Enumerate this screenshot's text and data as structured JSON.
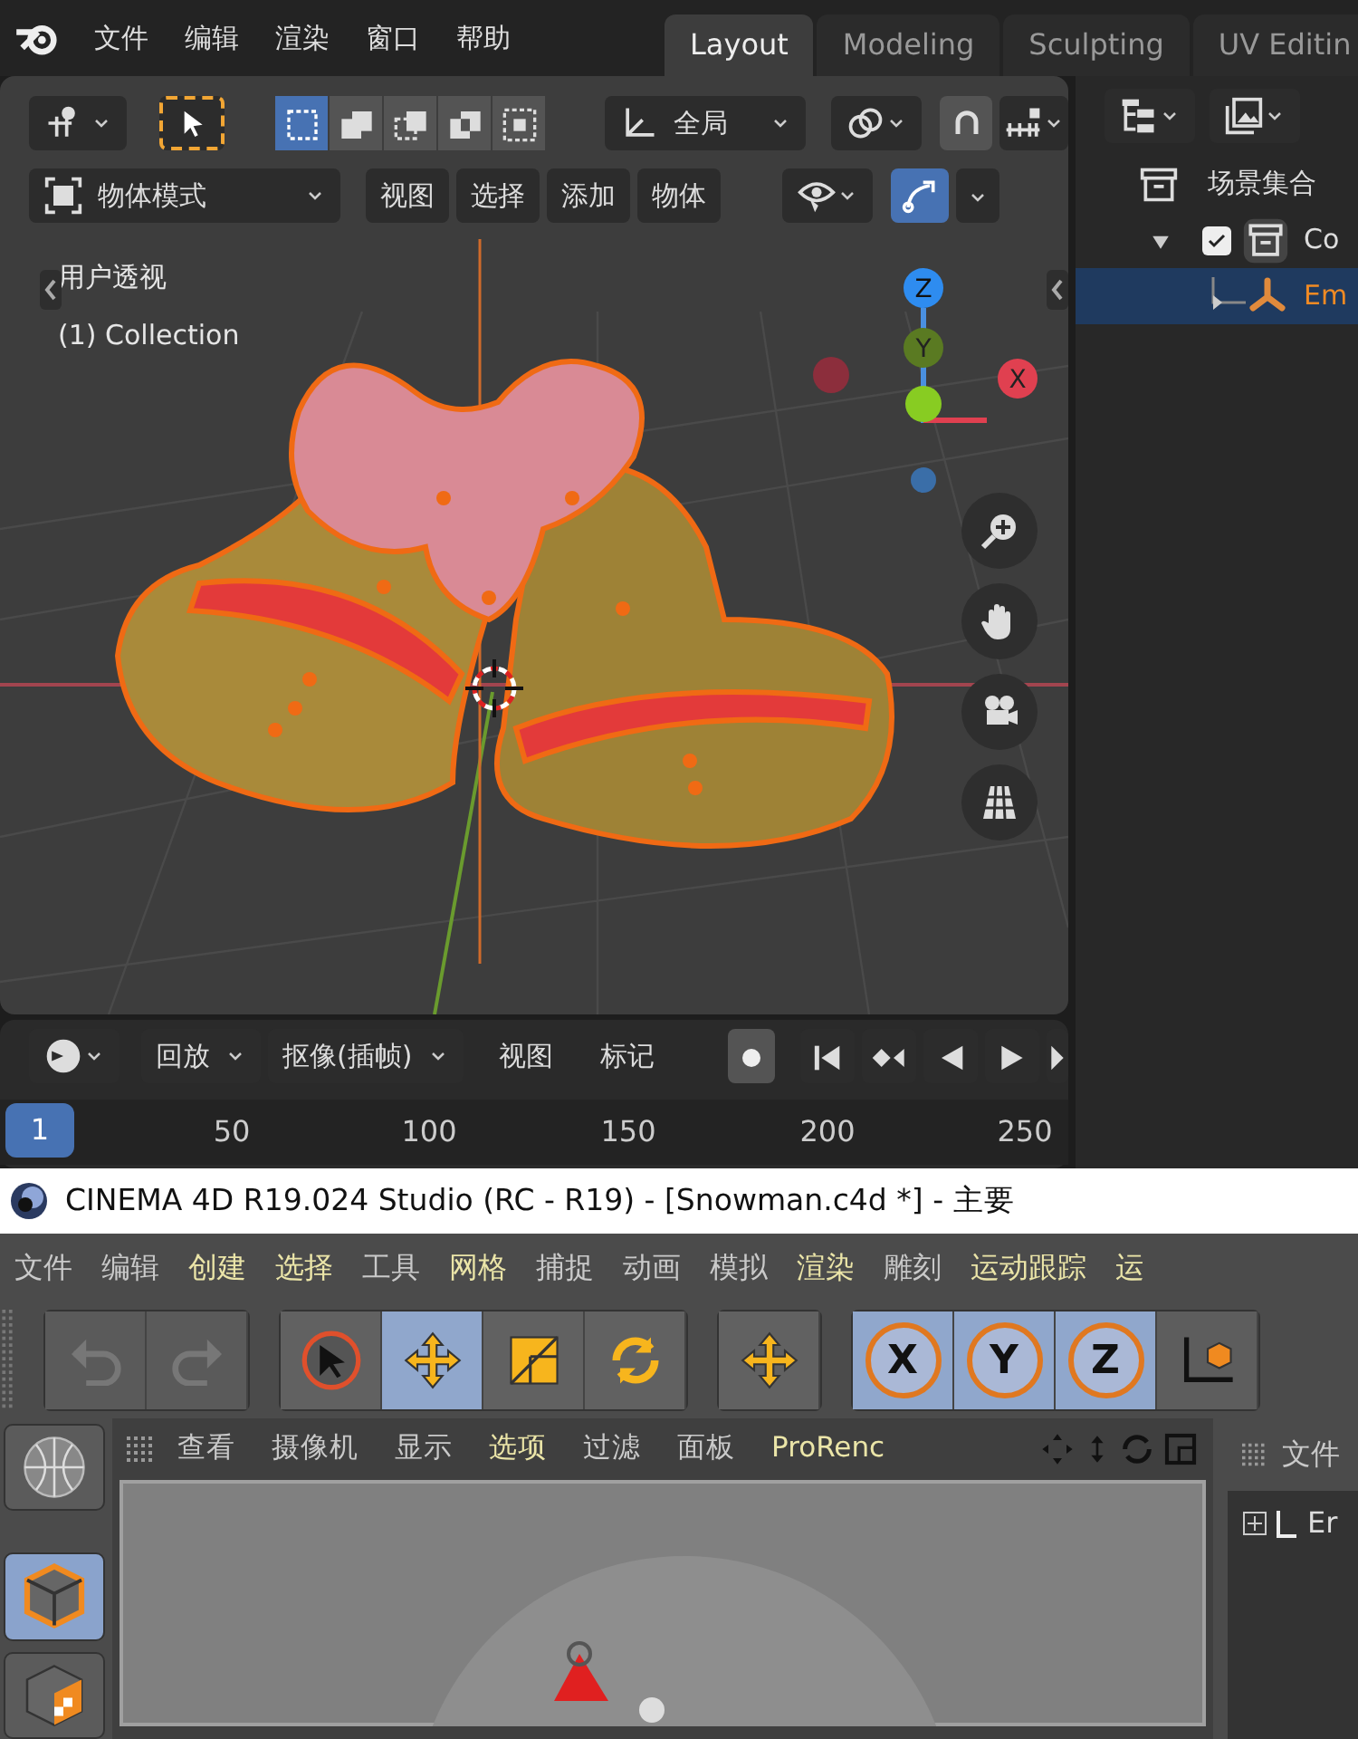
{
  "blender": {
    "menu": [
      "文件",
      "编辑",
      "渲染",
      "窗口",
      "帮助"
    ],
    "workspace_tabs": [
      {
        "label": "Layout",
        "selected": true
      },
      {
        "label": "Modeling",
        "selected": false
      },
      {
        "label": "Sculpting",
        "selected": false
      },
      {
        "label": "UV Editin",
        "selected": false
      }
    ],
    "select_modes": [
      {
        "kind": "new",
        "selected": true
      },
      {
        "kind": "extend",
        "selected": false
      },
      {
        "kind": "subtract",
        "selected": false
      },
      {
        "kind": "difference",
        "selected": false
      },
      {
        "kind": "intersect",
        "selected": false
      }
    ],
    "orientation": "全局",
    "snap_on": false,
    "mode": "物体模式",
    "header_menus": [
      "视图",
      "选择",
      "添加",
      "物体"
    ],
    "gizmo_toggle_on": true,
    "overlay_texts": [
      "用户透视",
      "(1) Collection"
    ],
    "gizmo_labels": {
      "z": "Z",
      "y": "Y",
      "x": "X"
    },
    "outliner": {
      "title": "场景集合",
      "items": [
        {
          "label": "Co",
          "checked": true,
          "selected": false,
          "children": [
            {
              "label": "Em",
              "selected": true
            }
          ]
        }
      ]
    },
    "timeline": {
      "playback": "回放",
      "keying": "抠像(插帧)",
      "menus": [
        "视图",
        "标记"
      ],
      "current_frame": "1",
      "ticks": [
        "50",
        "100",
        "150",
        "200",
        "250"
      ]
    }
  },
  "c4d": {
    "title": "CINEMA 4D R19.024 Studio (RC - R19) - [Snowman.c4d *] - 主要",
    "menu": [
      {
        "label": "文件",
        "highlighted": false
      },
      {
        "label": "编辑",
        "highlighted": false
      },
      {
        "label": "创建",
        "highlighted": true
      },
      {
        "label": "选择",
        "highlighted": true
      },
      {
        "label": "工具",
        "highlighted": false
      },
      {
        "label": "网格",
        "highlighted": true
      },
      {
        "label": "捕捉",
        "highlighted": false
      },
      {
        "label": "动画",
        "highlighted": false
      },
      {
        "label": "模拟",
        "highlighted": false
      },
      {
        "label": "渲染",
        "highlighted": true
      },
      {
        "label": "雕刻",
        "highlighted": false
      },
      {
        "label": "运动跟踪",
        "highlighted": true
      },
      {
        "label": "运",
        "highlighted": true
      }
    ],
    "history": [
      {
        "kind": "undo",
        "disabled": true
      },
      {
        "kind": "redo",
        "disabled": true
      }
    ],
    "tools": [
      {
        "kind": "select",
        "selected": false
      },
      {
        "kind": "move",
        "selected": true
      },
      {
        "kind": "scale",
        "selected": false
      },
      {
        "kind": "rotate",
        "selected": false
      }
    ],
    "axis_locks": [
      {
        "label": "X",
        "selected": true
      },
      {
        "label": "Y",
        "selected": true
      },
      {
        "label": "Z",
        "selected": true
      }
    ],
    "mode_tools": [
      {
        "kind": "globe",
        "selected": false
      },
      {
        "kind": "model",
        "selected": true
      },
      {
        "kind": "texture",
        "selected": false
      }
    ],
    "viewport_menu": [
      {
        "label": "查看",
        "highlighted": false
      },
      {
        "label": "摄像机",
        "highlighted": false
      },
      {
        "label": "显示",
        "highlighted": false
      },
      {
        "label": "选项",
        "highlighted": true
      },
      {
        "label": "过滤",
        "highlighted": false
      },
      {
        "label": "面板",
        "highlighted": false
      },
      {
        "label": "ProRenc",
        "highlighted": true
      }
    ],
    "object_manager": {
      "menu": "文件",
      "item": "Er"
    }
  }
}
